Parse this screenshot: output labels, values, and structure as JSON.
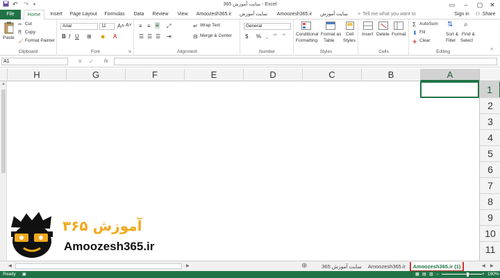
{
  "window": {
    "title": "ﺳﺎﯾﺖ آﻣﻮزش 365 - Excel",
    "sign_in": "Sign in"
  },
  "tabs": [
    "File",
    "Home",
    "Insert",
    "Page Layout",
    "Formulas",
    "Data",
    "Review",
    "View",
    "Amoozesh365.ir",
    "ﺳﺎﯾﺖ آﻣﻮزش 365",
    "Amoozesh365.ir",
    "ﺳﺎﯾﺖ آﻣﻮزش 365"
  ],
  "tell_me": "Tell me what you want to do...",
  "share": "Share",
  "clipboard": {
    "paste": "Paste",
    "cut": "Cut",
    "copy": "Copy",
    "format_painter": "Format Painter",
    "label": "Clipboard"
  },
  "font": {
    "name": "Arial",
    "size": "11",
    "label": "Font"
  },
  "alignment": {
    "wrap": "Wrap Text",
    "merge": "Merge & Center",
    "label": "Alignment"
  },
  "number": {
    "format": "General",
    "label": "Number"
  },
  "styles": {
    "conditional": "Conditional",
    "formatting": "Formatting",
    "format_as": "Format as",
    "table": "Table",
    "cell": "Cell",
    "cell_styles": "Styles",
    "label": "Styles"
  },
  "cells": {
    "insert": "Insert",
    "delete": "Delete",
    "format": "Format",
    "label": "Cells"
  },
  "editing": {
    "autosum": "AutoSum",
    "fill": "Fill",
    "clear": "Clear",
    "sort": "Sort &",
    "filter": "Filter",
    "find": "Find &",
    "select": "Select",
    "label": "Editing"
  },
  "formula_bar": {
    "name_box": "A1",
    "fx": "fx",
    "value": ""
  },
  "columns": [
    "H",
    "G",
    "F",
    "E",
    "D",
    "C",
    "B",
    "A"
  ],
  "rows": [
    "1",
    "2",
    "3",
    "4",
    "5",
    "6",
    "7",
    "8",
    "9",
    "10",
    "11"
  ],
  "sheets": [
    "365 ﺳﺎﯾﺖ آﻣﻮزش",
    "Amoozesh365.ir",
    "Amoozesh365.ir (1)"
  ],
  "status": {
    "ready": "Ready",
    "zoom": "190%"
  },
  "logo": {
    "url": "Amoozesh365.ir",
    "persian": "آﻣﻮزش ۳۶۵"
  },
  "colors": {
    "excel_green": "#217346",
    "accent_red": "#d03030"
  }
}
